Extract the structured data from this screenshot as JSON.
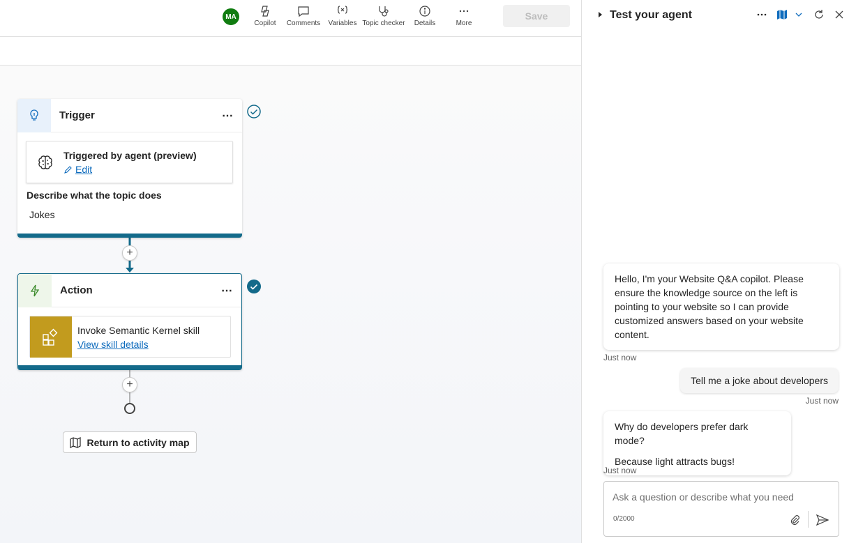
{
  "toolbar": {
    "avatar_initials": "MA",
    "buttons": [
      {
        "label": "Copilot",
        "icon": "copilot-icon"
      },
      {
        "label": "Comments",
        "icon": "comment-icon"
      },
      {
        "label": "Variables",
        "icon": "variables-icon"
      },
      {
        "label": "Topic checker",
        "icon": "stethoscope-icon"
      },
      {
        "label": "Details",
        "icon": "info-icon"
      },
      {
        "label": "More",
        "icon": "more-icon"
      }
    ],
    "save_label": "Save"
  },
  "canvas": {
    "trigger_node": {
      "title": "Trigger",
      "more": "⋯",
      "card_title": "Triggered by agent (preview)",
      "edit_label": "Edit",
      "describe_label": "Describe what the topic does",
      "describe_value": "Jokes"
    },
    "action_node": {
      "title": "Action",
      "more": "⋯",
      "card_title": "Invoke Semantic Kernel skill",
      "link_label": "View skill details"
    },
    "add_node": "+",
    "return_label": "Return to activity map"
  },
  "panel": {
    "title": "Test your agent",
    "messages": [
      {
        "role": "bot",
        "text": "Hello, I'm your Website Q&A copilot. Please ensure the knowledge source on the left is pointing to your website so I can provide customized answers based on your website content.",
        "time": "Just now"
      },
      {
        "role": "user",
        "text": "Tell me a joke about developers",
        "time": "Just now"
      },
      {
        "role": "bot",
        "lines": [
          "Why do developers prefer dark mode?",
          "Because light attracts bugs!"
        ],
        "time": "Just now"
      }
    ],
    "input_placeholder": "Ask a question or describe what you need",
    "counter": "0/2000"
  },
  "colors": {
    "accent": "#136a8a",
    "link": "#0f6cbd",
    "avatar_bg": "#107c10",
    "skill_tile": "#c29b1e"
  }
}
